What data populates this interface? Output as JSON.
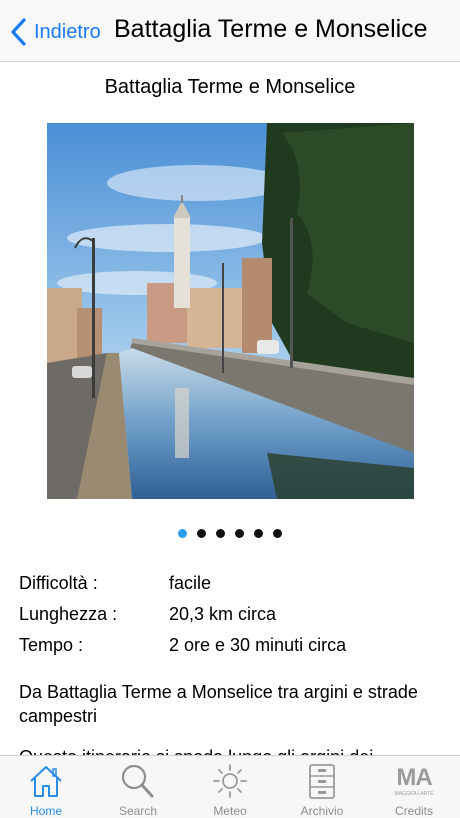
{
  "nav": {
    "back_label": "Indietro",
    "title": "Battaglia Terme e Monselice"
  },
  "page": {
    "title": "Battaglia Terme e Monselice"
  },
  "carousel": {
    "total": 6,
    "active_index": 0
  },
  "info": [
    {
      "label": "Difficoltà :",
      "value": "facile"
    },
    {
      "label": "Lunghezza :",
      "value": "20,3 km circa"
    },
    {
      "label": "Tempo :",
      "value": "2 ore e 30 minuti circa"
    }
  ],
  "description": "Da Battaglia Terme a Monselice tra argini e strade campestri",
  "description_partial": "Questo itinerario si snoda lungo gli argini dei",
  "tabs": [
    {
      "label": "Home",
      "icon": "home-icon",
      "active": true
    },
    {
      "label": "Search",
      "icon": "search-icon",
      "active": false
    },
    {
      "label": "Meteo",
      "icon": "sun-icon",
      "active": false
    },
    {
      "label": "Archivio",
      "icon": "archive-cabinet-icon",
      "active": false
    },
    {
      "label": "Credits",
      "icon": "ma-logo-icon",
      "active": false
    }
  ],
  "credits_logo": {
    "text": "MA",
    "subtext": "MAGGIOLI ARTE"
  },
  "colors": {
    "accent": "#1a7cf5",
    "active_tab": "#2a8ee8",
    "active_dot": "#2a9df4",
    "inactive": "#8e8e8e"
  }
}
